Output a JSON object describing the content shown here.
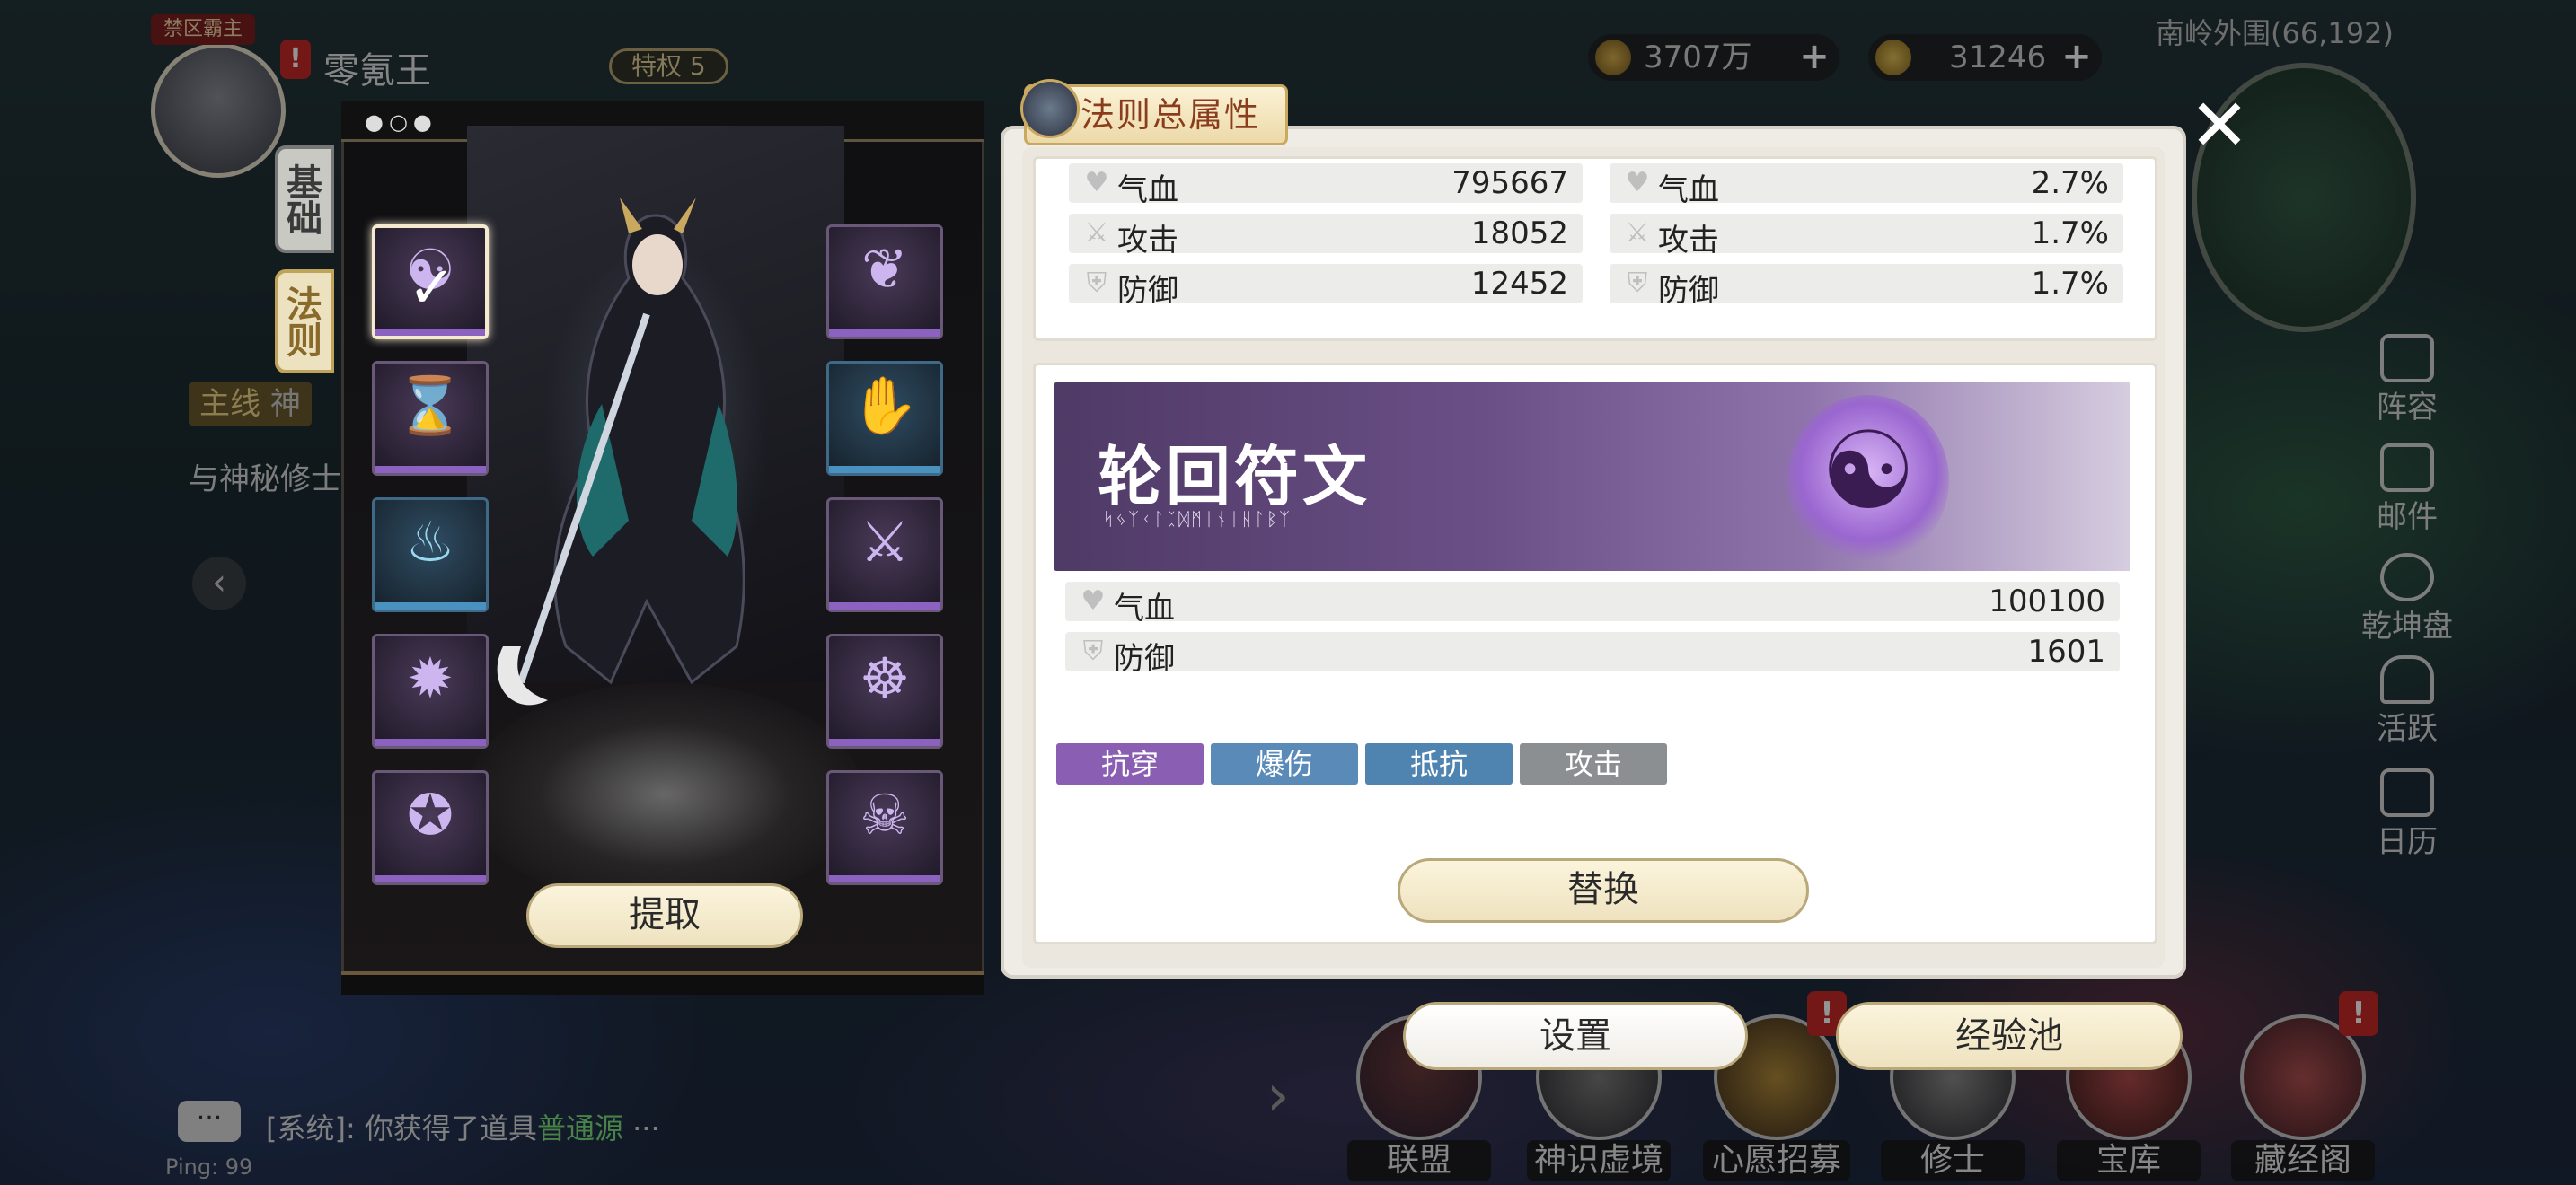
{
  "hud": {
    "zone_badge": "禁区霸主",
    "alert_mark": "!",
    "player_name": "零氪王",
    "vip_label": "特权 5",
    "currency_gold": "3707万",
    "currency_jade": "31246",
    "plus": "+",
    "location": "南岭外围(66,192)",
    "quest_tag": "主线",
    "quest_tag_tail": "神",
    "quest_text": "与神秘修士",
    "left_arrow": "‹",
    "right_arrow": "›",
    "chat_icon": "···",
    "chat_prefix": "[系统]: 你获得了道具",
    "chat_item": "普通源",
    "chat_more": "···",
    "ping": "Ping: 99"
  },
  "side_menu": [
    {
      "label": "阵容",
      "icon": "formation-icon"
    },
    {
      "label": "邮件",
      "icon": "mail-icon"
    },
    {
      "label": "乾坤盘",
      "icon": "compass-icon"
    },
    {
      "label": "活跃",
      "icon": "bell-icon"
    },
    {
      "label": "日历",
      "icon": "calendar-icon"
    }
  ],
  "bottom_menu": [
    {
      "label": "联盟"
    },
    {
      "label": "神识虚境"
    },
    {
      "label": "心愿招募"
    },
    {
      "label": "修士"
    },
    {
      "label": "宝库"
    },
    {
      "label": "藏经阁"
    }
  ],
  "left_panel": {
    "dots": "●○●",
    "tabs": [
      {
        "label": "基础",
        "active": false
      },
      {
        "label": "法则",
        "active": true
      }
    ],
    "slots_left": [
      {
        "icon": "reincarnation-embryo-icon",
        "selected": true,
        "glyph": "☯",
        "check": "✓"
      },
      {
        "icon": "hourglass-icon",
        "selected": false,
        "glyph": "⌛"
      },
      {
        "icon": "blue-flame-icon",
        "selected": false,
        "glyph": "♨"
      },
      {
        "icon": "spiked-orb-icon",
        "selected": false,
        "glyph": "✹"
      },
      {
        "icon": "pentagram-icon",
        "selected": false,
        "glyph": "✪"
      }
    ],
    "slots_right": [
      {
        "icon": "butterfly-icon",
        "glyph": "❦"
      },
      {
        "icon": "puppet-hand-icon",
        "glyph": "✋"
      },
      {
        "icon": "crossed-swords-icon",
        "glyph": "⚔"
      },
      {
        "icon": "meditating-figure-icon",
        "glyph": "☸"
      },
      {
        "icon": "skeletal-hand-icon",
        "glyph": "☠"
      }
    ],
    "extract_label": "提取"
  },
  "right_panel": {
    "header_title": "法则总属性",
    "close_glyph": "✕",
    "total_stats_flat": [
      {
        "name": "气血",
        "value": "795667",
        "icon": "heart-icon",
        "glyph": "♥"
      },
      {
        "name": "攻击",
        "value": "18052",
        "icon": "sword-icon",
        "glyph": "⚔"
      },
      {
        "name": "防御",
        "value": "12452",
        "icon": "shield-icon",
        "glyph": "⛨"
      }
    ],
    "total_stats_pct": [
      {
        "name": "气血",
        "value": "2.7%",
        "icon": "heart-icon",
        "glyph": "♥"
      },
      {
        "name": "攻击",
        "value": "1.7%",
        "icon": "sword-icon",
        "glyph": "⚔"
      },
      {
        "name": "防御",
        "value": "1.7%",
        "icon": "shield-icon",
        "glyph": "⛨"
      }
    ],
    "rune": {
      "title": "轮回符文",
      "script": "ᛋᛃᛉᚲᛚᛈᛞᛗᛁᚾᛁᚺᛚᛒᛉ",
      "emblem": "embryo-emblem-icon",
      "emblem_glyph": "☯",
      "stats": [
        {
          "name": "气血",
          "value": "100100",
          "icon": "heart-icon",
          "glyph": "♥"
        },
        {
          "name": "防御",
          "value": "1601",
          "icon": "shield-icon",
          "glyph": "⛨"
        }
      ],
      "tags": [
        {
          "label": "抗穿",
          "color": "#8a5fb3"
        },
        {
          "label": "爆伤",
          "color": "#5a8bb8"
        },
        {
          "label": "抵抗",
          "color": "#4f84b0"
        },
        {
          "label": "攻击",
          "color": "#8c8f92"
        }
      ],
      "replace_label": "替换"
    }
  },
  "bottom_buttons": {
    "settings_label": "设置",
    "exp_pool_label": "经验池"
  },
  "colors": {
    "accent_cream": "#f4ead0",
    "rune_purple": "#6a4f86",
    "alert_red": "#c82828"
  }
}
